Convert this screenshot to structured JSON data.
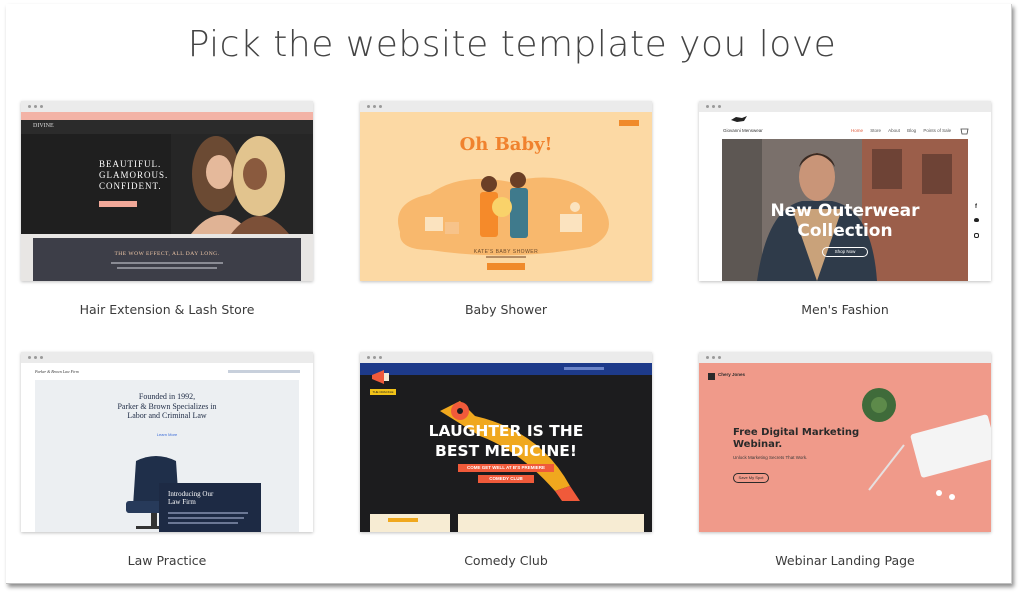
{
  "page": {
    "title": "Pick the website template you love"
  },
  "templates": [
    {
      "name": "Hair Extension & Lash Store",
      "brand": "DIVINE",
      "hero_lines": [
        "BEAUTIFUL.",
        "GLAMOROUS.",
        "CONFIDENT."
      ],
      "band_title": "THE WOW EFFECT, ALL DAY LONG."
    },
    {
      "name": "Baby Shower",
      "hero_title": "Oh Baby!",
      "event_title": "KATE'S BABY SHOWER"
    },
    {
      "name": "Men's Fashion",
      "brand": "Giovanni Menswear",
      "nav": [
        "Home",
        "Store",
        "About",
        "Blog",
        "Points of Sale"
      ],
      "hero_lines": [
        "New Outerwear",
        "Collection"
      ],
      "cta": "Shop Now"
    },
    {
      "name": "Law Practice",
      "brand": "Parker & Brown Law Firm",
      "hero_lines": [
        "Founded in 1992,",
        "Parker & Brown Specializes in",
        "Labor and Criminal Law"
      ],
      "link": "Learn More",
      "panel_lines": [
        "Introducing Our",
        "Law Firm"
      ]
    },
    {
      "name": "Comedy Club",
      "hero_lines": [
        "LAUGHTER IS THE",
        "BEST MEDICINE!"
      ],
      "subtitle": "COME GET WELL AT B'S PREMIERE",
      "cta": "COMEDY CLUB",
      "badge": "THE CRACKLE"
    },
    {
      "name": "Webinar Landing Page",
      "brand": "Chery Jones",
      "hero_lines": [
        "Free Digital Marketing",
        "Webinar."
      ],
      "sub": "Unlock Marketing Secrets That Work.",
      "cta": "Save My Spot"
    }
  ]
}
